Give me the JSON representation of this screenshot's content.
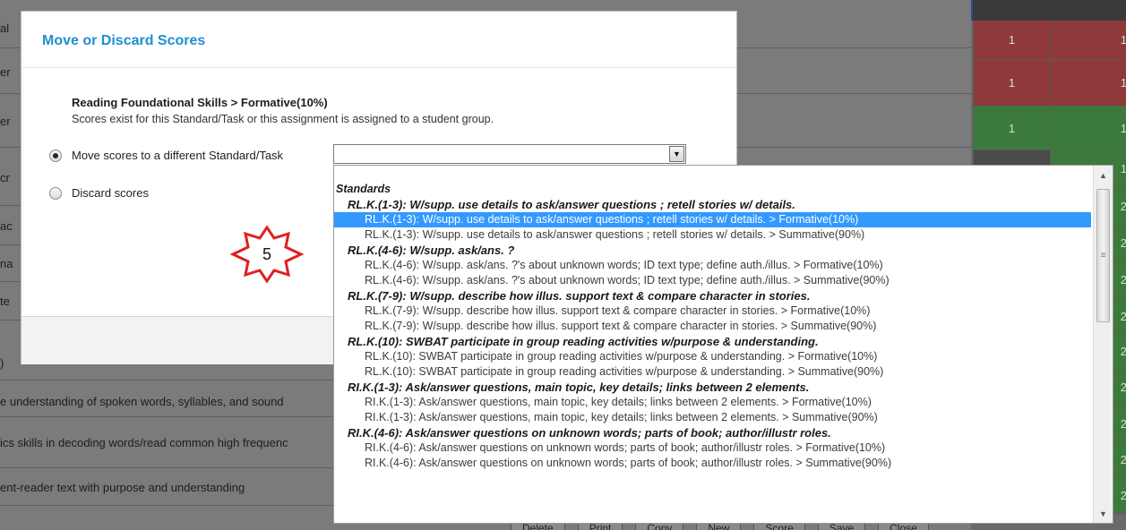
{
  "background": {
    "rows": [
      {
        "label": "al"
      },
      {
        "label": "er"
      },
      {
        "label": "er"
      },
      {
        "label": "cr"
      },
      {
        "label": "ac"
      },
      {
        "label": "na"
      },
      {
        "label": "te"
      },
      {
        "label": ")"
      },
      {
        "label": "e understanding of spoken words, syllables, and sound"
      },
      {
        "label": "ics skills in decoding words/read common high frequenc"
      },
      {
        "label": "ent-reader text with purpose and understanding"
      }
    ],
    "grid_values": [
      "1",
      "1",
      "1",
      "1",
      "2",
      "2",
      "2",
      "2",
      "2",
      "2",
      "2",
      "2",
      "2"
    ],
    "buttons": [
      "Delete",
      "Print",
      "Copy",
      "New",
      "Score",
      "Save",
      "Close"
    ]
  },
  "modal": {
    "title": "Move or Discard Scores",
    "breadcrumb": "Reading Foundational Skills > Formative(10%)",
    "explanation": "Scores exist for this Standard/Task or this assignment is assigned to a student group.",
    "move_option_label": "Move scores to a different Standard/Task",
    "discard_option_label": "Discard scores",
    "move_selected": true,
    "select_value": ""
  },
  "annotation": {
    "step_number": "5",
    "color": "#e02020"
  },
  "dropdown": {
    "group_header": "Standards",
    "items": [
      {
        "type": "sub",
        "label": "RL.K.(1-3): W/supp. use details to ask/answer questions ; retell stories w/ details."
      },
      {
        "type": "option",
        "label": "RL.K.(1-3): W/supp. use details to ask/answer questions ; retell stories w/ details. > Formative(10%)",
        "selected": true
      },
      {
        "type": "option",
        "label": "RL.K.(1-3): W/supp. use details to ask/answer questions ; retell stories w/ details. > Summative(90%)"
      },
      {
        "type": "sub",
        "label": "RL.K.(4-6): W/supp. ask/ans. ?"
      },
      {
        "type": "option",
        "label": "RL.K.(4-6): W/supp. ask/ans. ?'s about unknown words; ID text type; define auth./illus. > Formative(10%)"
      },
      {
        "type": "option",
        "label": "RL.K.(4-6): W/supp. ask/ans. ?'s about unknown words; ID text type; define auth./illus. > Summative(90%)"
      },
      {
        "type": "sub",
        "label": "RL.K.(7-9): W/supp. describe how illus. support text & compare character in stories."
      },
      {
        "type": "option",
        "label": "RL.K.(7-9): W/supp. describe how illus. support text & compare character in stories. > Formative(10%)"
      },
      {
        "type": "option",
        "label": "RL.K.(7-9): W/supp. describe how illus. support text & compare character in stories. > Summative(90%)"
      },
      {
        "type": "sub",
        "label": "RL.K.(10): SWBAT participate in group reading activities w/purpose & understanding."
      },
      {
        "type": "option",
        "label": "RL.K.(10): SWBAT participate in group reading activities w/purpose & understanding. > Formative(10%)"
      },
      {
        "type": "option",
        "label": "RL.K.(10): SWBAT participate in group reading activities w/purpose & understanding. > Summative(90%)"
      },
      {
        "type": "sub",
        "label": "RI.K.(1-3): Ask/answer questions, main topic, key details; links between 2 elements."
      },
      {
        "type": "option",
        "label": "RI.K.(1-3): Ask/answer questions, main topic, key details; links between 2 elements. > Formative(10%)"
      },
      {
        "type": "option",
        "label": "RI.K.(1-3): Ask/answer questions, main topic, key details; links between 2 elements. > Summative(90%)"
      },
      {
        "type": "sub",
        "label": "RI.K.(4-6): Ask/answer questions on unknown words; parts of book; author/illustr roles."
      },
      {
        "type": "option",
        "label": "RI.K.(4-6): Ask/answer questions on unknown words; parts of book; author/illustr roles. > Formative(10%)"
      },
      {
        "type": "option",
        "label": "RI.K.(4-6): Ask/answer questions on unknown words; parts of book; author/illustr roles. > Summative(90%)"
      }
    ]
  },
  "icons": {
    "dropdown_arrow": "chevron-down-icon",
    "scroll_up": "scroll-up-icon",
    "scroll_down": "scroll-down-icon",
    "scroll_grip": "scroll-grip-icon",
    "annotation": "star-badge-icon"
  }
}
